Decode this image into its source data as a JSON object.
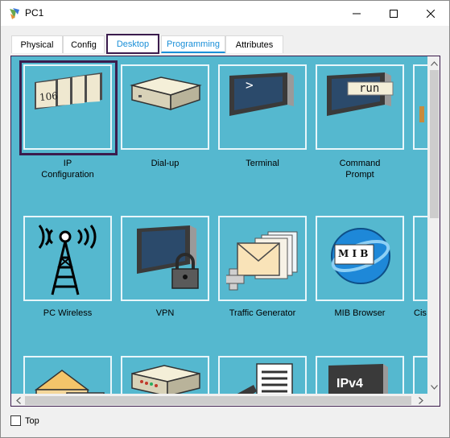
{
  "window": {
    "title": "PC1"
  },
  "tabs": [
    {
      "label": "Physical"
    },
    {
      "label": "Config"
    },
    {
      "label": "Desktop"
    },
    {
      "label": "Programming"
    },
    {
      "label": "Attributes"
    }
  ],
  "active_tab": "Desktop",
  "apps": [
    {
      "label_line1": "IP",
      "label_line2": "Configuration",
      "icon": "ip-config-icon",
      "icon_text": "106"
    },
    {
      "label_line1": "Dial-up",
      "label_line2": "",
      "icon": "modem-icon"
    },
    {
      "label_line1": "Terminal",
      "label_line2": "",
      "icon": "terminal-icon",
      "icon_text": ">"
    },
    {
      "label_line1": "Command",
      "label_line2": "Prompt",
      "icon": "command-prompt-icon",
      "icon_text": "run"
    },
    {
      "label_line1": "PC Wireless",
      "label_line2": "",
      "icon": "wireless-tower-icon"
    },
    {
      "label_line1": "VPN",
      "label_line2": "",
      "icon": "vpn-lock-icon"
    },
    {
      "label_line1": "Traffic Generator",
      "label_line2": "",
      "icon": "traffic-generator-icon"
    },
    {
      "label_line1": "MIB Browser",
      "label_line2": "",
      "icon": "mib-browser-icon",
      "icon_text": "M I B"
    },
    {
      "label_line1": "Cis",
      "label_line2": "",
      "icon": "partial-icon"
    },
    {
      "icon": "email-icon"
    },
    {
      "icon": "router-device-icon"
    },
    {
      "icon": "text-editor-icon"
    },
    {
      "icon": "ipv4-icon",
      "icon_text": "IPv4"
    }
  ],
  "bottom": {
    "top_label": "Top",
    "top_checked": false
  },
  "colors": {
    "content_bg": "#55b8cf",
    "selection": "#3b1c4d",
    "tab_active": "#1a8fd8"
  }
}
